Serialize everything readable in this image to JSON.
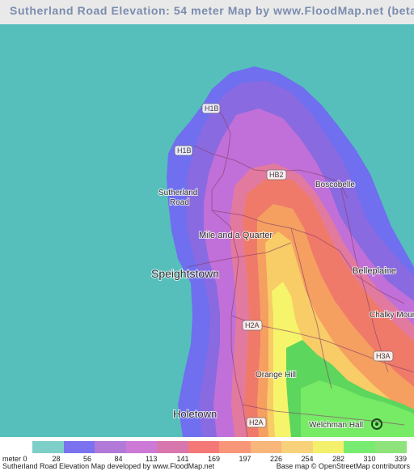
{
  "title": "Sutherland Road Elevation: 54 meter Map by www.FloodMap.net (beta)",
  "colors": {
    "sea": "#56bfbc",
    "coast": "#7070ee",
    "low": "#8a6ae0",
    "mid": "#cc7ad8",
    "high1": "#e8789a",
    "high2": "#f07a6a",
    "high3": "#f5a060",
    "high4": "#f8cc66",
    "peak": "#f6f46a",
    "green": "#77ea66",
    "green2": "#5cd65c"
  },
  "places": {
    "sutherland_road_1": "Sutherland",
    "sutherland_road_2": "Road",
    "boscobelle": "Boscobelle",
    "mile_and_a_quarter": "Mile and a Quarter",
    "speightstown": "Speightstown",
    "belleplaine": "Belleplaine",
    "chalky_mount": "Chalky Moun",
    "orange_hill": "Orange Hill",
    "holetown": "Holetown",
    "welchman_hall": "Welchman Hall"
  },
  "roads": {
    "h1b_a": "H1B",
    "h1b_b": "H1B",
    "hb2": "HB2",
    "h2a_a": "H2A",
    "h2a_b": "H2A",
    "h3a": "H3A"
  },
  "marker_icon": "location-marker-icon",
  "legend": {
    "unit": "meter 0",
    "items": [
      {
        "color": "#7ecfc8",
        "label": "28"
      },
      {
        "color": "#7a72ee",
        "label": "56"
      },
      {
        "color": "#b27ad8",
        "label": "84"
      },
      {
        "color": "#cc7ad6",
        "label": "113"
      },
      {
        "color": "#d876ae",
        "label": "141"
      },
      {
        "color": "#f57878",
        "label": "169"
      },
      {
        "color": "#f8967a",
        "label": "197"
      },
      {
        "color": "#f8b67a",
        "label": "226"
      },
      {
        "color": "#f8d27a",
        "label": "254"
      },
      {
        "color": "#f4f06c",
        "label": "282"
      },
      {
        "color": "#78ec70",
        "label": "310"
      },
      {
        "color": "#8ee47a",
        "label": "339"
      }
    ],
    "credit_left": "Sutherland Road Elevation Map developed by www.FloodMap.net",
    "credit_right": "Base map © OpenStreetMap contributors"
  }
}
